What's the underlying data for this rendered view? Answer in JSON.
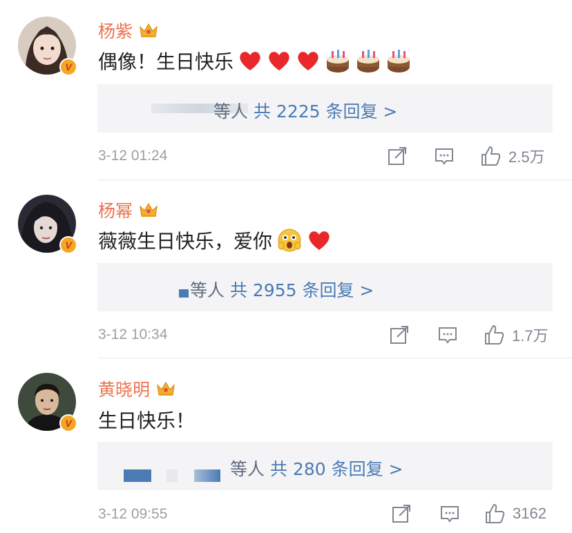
{
  "comments": [
    {
      "author": "杨紫",
      "text": "偶像！生日快乐",
      "emojis": [
        "heart",
        "heart",
        "heart",
        "cake",
        "cake",
        "cake"
      ],
      "replies_prefix": "等人",
      "replies_link": "共 2225 条回复 >",
      "time": "3-12 01:24",
      "likes": "2.5万"
    },
    {
      "author": "杨幂",
      "text": "薇薇生日快乐，爱你",
      "emojis": [
        "shocked-face",
        "heart"
      ],
      "replies_prefix": "等人",
      "replies_link": "共 2955 条回复 >",
      "time": "3-12 10:34",
      "likes": "1.7万"
    },
    {
      "author": "黄晓明",
      "text": "生日快乐！",
      "emojis": [],
      "replies_prefix": "等人",
      "replies_link": "共 280 条回复 >",
      "time": "3-12 09:55",
      "likes": "3162"
    }
  ],
  "colors": {
    "author": "#eb7350",
    "reply_link": "#4a7bb3",
    "reply_bg": "#f4f4f6",
    "meta": "#9aa0a8",
    "badge": "#f5a623"
  },
  "icons": [
    "crown-icon",
    "verified-badge-icon",
    "share-icon",
    "comment-icon",
    "like-icon"
  ]
}
